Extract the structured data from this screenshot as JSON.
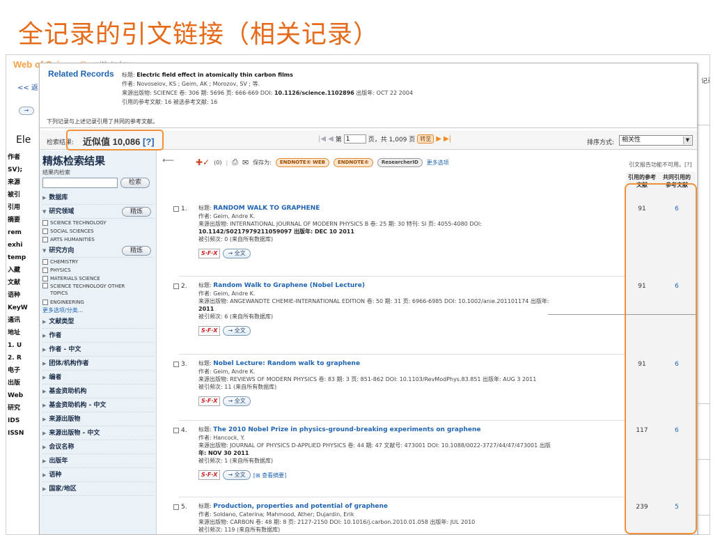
{
  "slide_title": "全记录的引文链接（相关记录）",
  "background": {
    "logo": "Web of Science®",
    "subtitle": "with Index",
    "back_link": "<< 返",
    "nav_button": "→",
    "heading": "Ele",
    "rail_labels": [
      "作者",
      "SV);",
      "来源",
      "被引",
      "引用",
      "摘要",
      "rem",
      "exhi",
      "temp",
      "入藏",
      "文献",
      "语种",
      "KeyW",
      "通讯",
      "地址",
      "1. U",
      "2. R",
      "电子",
      "出版",
      "Web",
      "研究",
      "IDS",
      "ISSN"
    ],
    "right_text": "记录"
  },
  "related_records": {
    "label": "Related Records",
    "title_prefix": "标题:",
    "title": "Electric field effect in atomically thin carbon films",
    "authors": "作者: Novoselov, KS ; Geim, AK ; Morozov, SV ; 等.",
    "source_prefix": "来源出版物: SCIENCE 卷: 306 期: 5696 页: 666-669 DOI:",
    "doi": "10.1126/science.1102896",
    "pub_year": "出版年: OCT 22 2004",
    "refs": "引用的参考文献: 16 被选参考文献: 16",
    "shared_note": "下列记录与上述记录引用了共同的参考文献。"
  },
  "results": {
    "label": "检索结果:",
    "count": "近似值 10,086",
    "help": "[?]",
    "page_prefix": "第",
    "page_value": "1",
    "page_suffix": "页，共 1,009 页",
    "go_label": "转至",
    "sort_label": "排序方式:",
    "sort_value": "相关性"
  },
  "sidebar": {
    "title": "精炼检索结果",
    "search_within": "结果内检索",
    "search_button": "检索",
    "refine_button": "精炼",
    "more_options": "更多选项/分类...",
    "facets": [
      {
        "label": "数据库",
        "open": false
      },
      {
        "label": "研究领域",
        "open": true,
        "options": [
          "SCIENCE TECHNOLOGY",
          "SOCIAL SCIENCES",
          "ARTS HUMANITIES"
        ]
      },
      {
        "label": "研究方向",
        "open": true,
        "options": [
          "CHEMISTRY",
          "PHYSICS",
          "MATERIALS SCIENCE",
          "SCIENCE TECHNOLOGY OTHER TOPICS",
          "ENGINEERING"
        ]
      },
      {
        "label": "文献类型"
      },
      {
        "label": "作者"
      },
      {
        "label": "作者 - 中文"
      },
      {
        "label": "团体/机构作者"
      },
      {
        "label": "编者"
      },
      {
        "label": "基金资助机构"
      },
      {
        "label": "基金资助机构 - 中文"
      },
      {
        "label": "来源出版物"
      },
      {
        "label": "来源出版物 - 中文"
      },
      {
        "label": "会议名称"
      },
      {
        "label": "出版年"
      },
      {
        "label": "语种"
      },
      {
        "label": "国家/地区"
      }
    ]
  },
  "toolbar": {
    "mark_count": "(0)",
    "save_to": "保存为:",
    "endnote_web": "ENDNOTE® WEB",
    "endnote": "ENDNOTE®",
    "researcher_id": "ResearcherID",
    "more_options": "更多选项",
    "cite_note": "引文报告功能不可用。[?]"
  },
  "columns": {
    "cited_refs": "引用的参考文献",
    "shared_refs": "共同引用的参考文献"
  },
  "records": [
    {
      "num": "1.",
      "title": "RANDOM WALK TO GRAPHENE",
      "authors": "作者: Geim, Andre K.",
      "source": "来源出版物: INTERNATIONAL JOURNAL OF MODERN PHYSICS B 卷: 25 期: 30 特刊: SI 页: 4055-4080 DOI:",
      "source2": "10.1142/S0217979211059097 出版年: DEC 10 2011",
      "times_cited": "被引频次: 0 (来自所有数据库)",
      "cited_refs": "91",
      "shared_refs": "6"
    },
    {
      "num": "2.",
      "title": "Random Walk to Graphene (Nobel Lecture)",
      "authors": "作者: Geim, Andre K.",
      "source": "来源出版物: ANGEWANDTE CHEMIE-INTERNATIONAL EDITION 卷: 50 期: 31 页: 6966-6985 DOI: 10.1002/anie.201101174 出版年:",
      "source2": "2011",
      "times_cited": "被引频次: 6 (来自所有数据库)",
      "cited_refs": "91",
      "shared_refs": "6"
    },
    {
      "num": "3.",
      "title": "Nobel Lecture: Random walk to graphene",
      "authors": "作者: Geim, Andre K.",
      "source": "来源出版物: REVIEWS OF MODERN PHYSICS 卷: 83 期: 3 页: 851-862 DOI: 10.1103/RevModPhys.83.851 出版年: AUG 3 2011",
      "source2": "",
      "times_cited": "被引频次: 11 (来自所有数据库)",
      "cited_refs": "91",
      "shared_refs": "6"
    },
    {
      "num": "4.",
      "title": "The 2010 Nobel Prize in physics-ground-breaking experiments on graphene",
      "authors": "作者: Hancock, Y.",
      "source": "来源出版物: JOURNAL OF PHYSICS D-APPLIED PHYSICS 卷: 44 期: 47 文献号: 473001 DOI: 10.1088/0022-3727/44/47/473001 出版",
      "source2": "年: NOV 30 2011",
      "times_cited": "被引频次: 1 (来自所有数据库)",
      "cited_refs": "117",
      "shared_refs": "6",
      "abstract_link": "[⊞ 查看摘要]"
    },
    {
      "num": "5.",
      "title": "Production, properties and potential of graphene",
      "authors": "作者: Soldano, Caterina; Mahmood, Ather; Dujardin, Erik",
      "source": "来源出版物: CARBON 卷: 48 期: 8 页: 2127-2150 DOI: 10.1016/j.carbon.2010.01.058 出版年: JUL 2010",
      "source2": "",
      "times_cited": "被引频次: 119 (来自所有数据库)",
      "cited_refs": "239",
      "shared_refs": "5"
    }
  ],
  "sfx_label": "S·F·X",
  "fulltext_label": "→ 全文",
  "title_prefix": "标题:",
  "colors": {
    "accent_orange": "#f0913a",
    "link_blue": "#1f64b2",
    "title_orange": "#e56a19"
  }
}
